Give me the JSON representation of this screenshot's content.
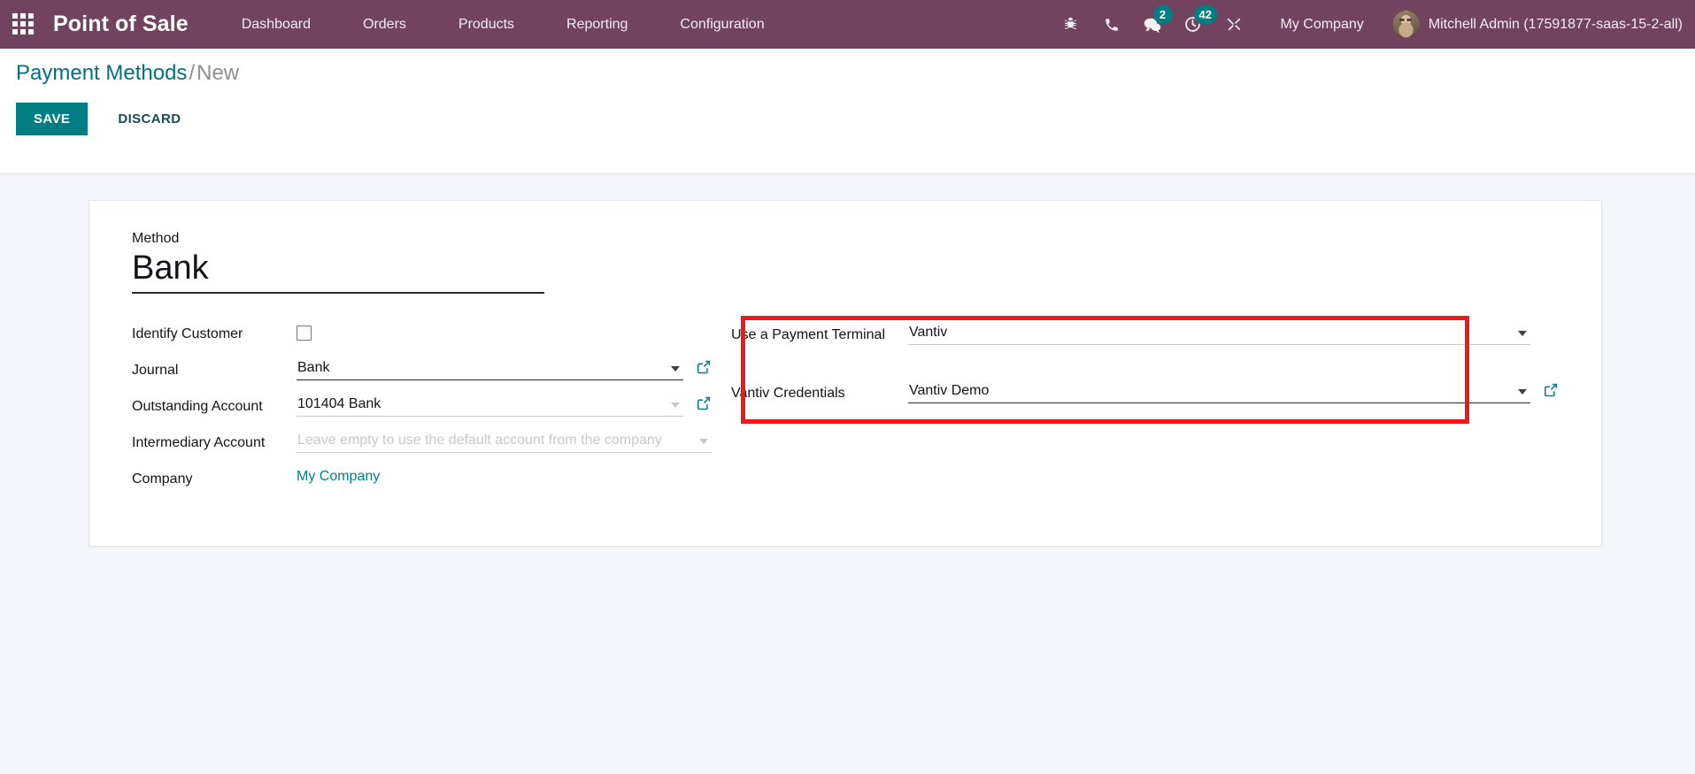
{
  "navbar": {
    "apps_icon": "apps-grid-icon",
    "brand": "Point of Sale",
    "menu": [
      {
        "label": "Dashboard"
      },
      {
        "label": "Orders"
      },
      {
        "label": "Products"
      },
      {
        "label": "Reporting"
      },
      {
        "label": "Configuration"
      }
    ],
    "icons": [
      {
        "name": "bug-icon",
        "badge": ""
      },
      {
        "name": "phone-icon",
        "badge": ""
      },
      {
        "name": "messages-icon",
        "badge": "2"
      },
      {
        "name": "activities-clock-icon",
        "badge": "42"
      },
      {
        "name": "tools-icon",
        "badge": ""
      }
    ],
    "company": "My Company",
    "user": "Mitchell Admin (17591877-saas-15-2-all)",
    "background_color": "#71435F",
    "badge_color": "#017E84"
  },
  "control_panel": {
    "breadcrumb_root": "Payment Methods",
    "breadcrumb_separator": "/",
    "breadcrumb_current": "New",
    "save_label": "SAVE",
    "discard_label": "DISCARD",
    "save_color": "#017E84"
  },
  "form": {
    "title_label": "Method",
    "title_value": "Bank",
    "left": {
      "identify_customer": {
        "label": "Identify Customer",
        "checked": false
      },
      "journal": {
        "label": "Journal",
        "value": "Bank",
        "has_external_link": true
      },
      "outstanding_account": {
        "label": "Outstanding Account",
        "value": "101404 Bank",
        "has_external_link": true
      },
      "intermediary_account": {
        "label": "Intermediary Account",
        "value": "",
        "placeholder": "Leave empty to use the default account from the company"
      },
      "company": {
        "label": "Company",
        "value": "My Company"
      }
    },
    "right": {
      "payment_terminal": {
        "label": "Use a Payment Terminal",
        "value": "Vantiv"
      },
      "vantiv_credentials": {
        "label": "Vantiv Credentials",
        "value": "Vantiv Demo",
        "has_external_link": true
      }
    }
  },
  "annotation": {
    "highlight_color": "#EE1A1A",
    "highlight_name": "payment-terminal-highlight-box"
  }
}
